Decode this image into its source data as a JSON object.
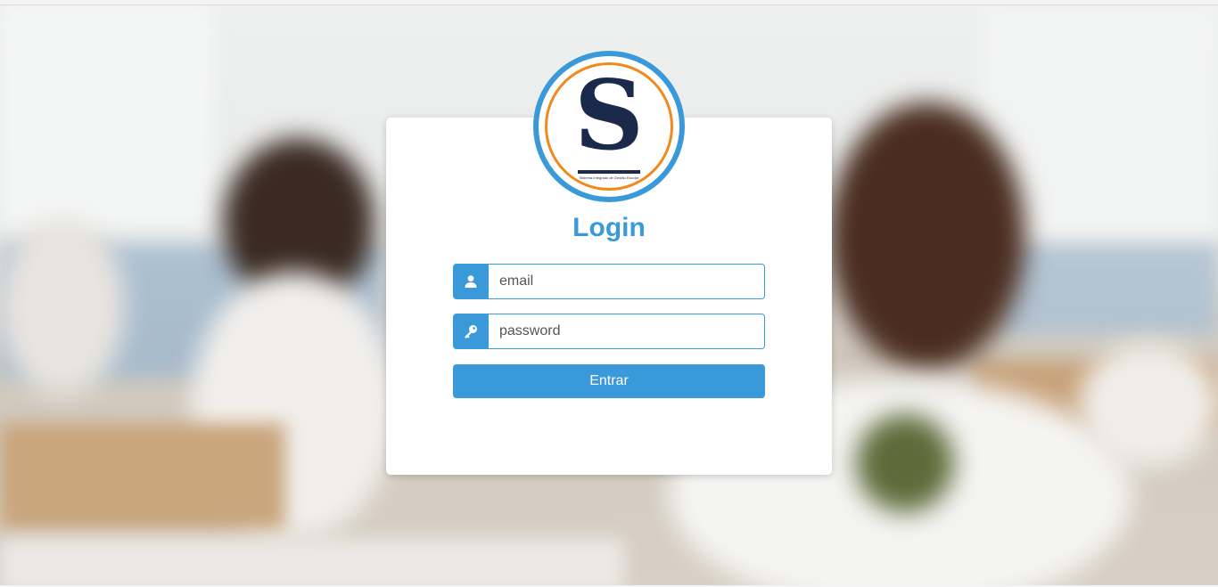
{
  "background": {
    "description_icon": "classroom-photo"
  },
  "logo": {
    "letter": "S",
    "caption": "Sistema Integrado de Gestão Escolar",
    "colors": {
      "ring_outer": "#3a9ad9",
      "ring_inner": "#f08a1c",
      "letter": "#1b2a4a"
    }
  },
  "login": {
    "title": "Login",
    "email": {
      "placeholder": "email",
      "value": "",
      "icon": "user-icon"
    },
    "password": {
      "placeholder": "password",
      "value": "",
      "icon": "key-icon"
    },
    "submit_label": "Entrar"
  },
  "colors": {
    "accent": "#3a9ad9",
    "card": "#ffffff"
  }
}
